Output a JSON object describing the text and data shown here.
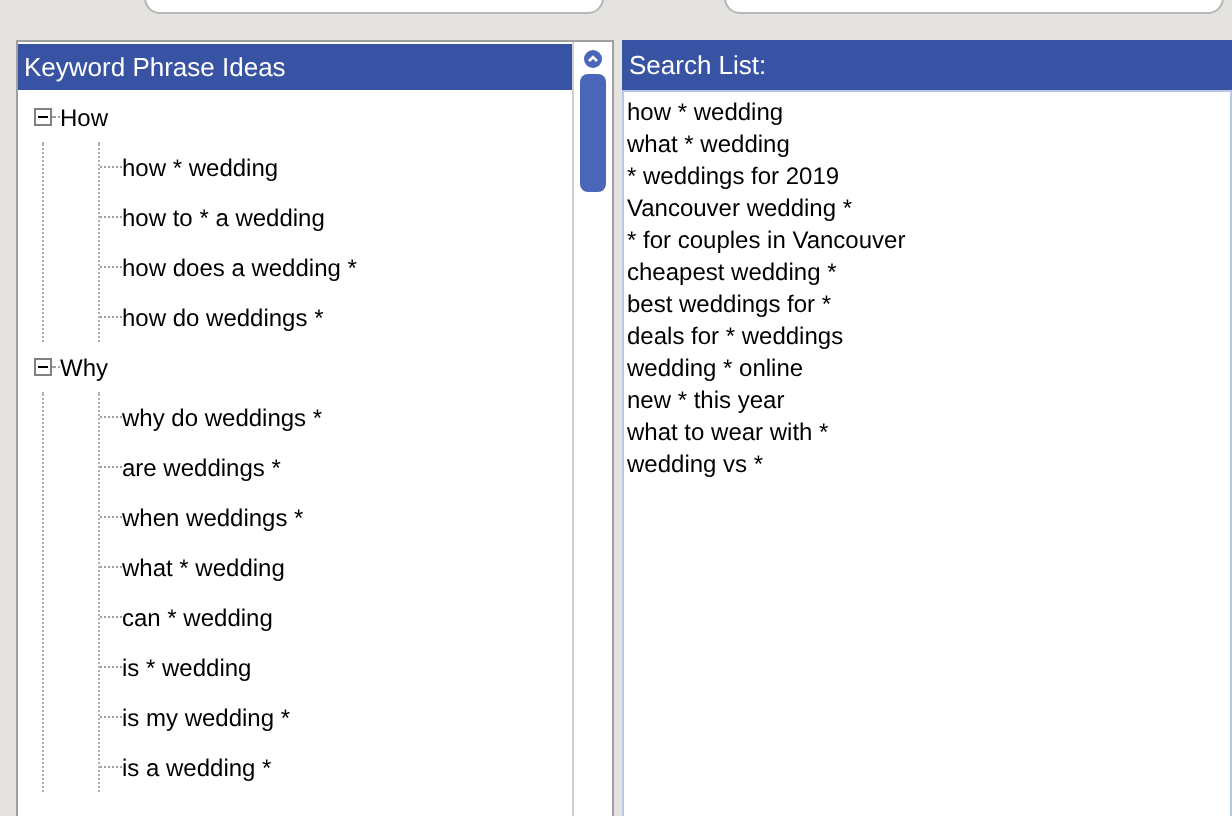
{
  "keyword_panel": {
    "title": "Keyword Phrase Ideas",
    "tree": [
      {
        "label": "How",
        "expanded": true,
        "children": [
          {
            "label": "how * wedding"
          },
          {
            "label": "how to * a wedding"
          },
          {
            "label": "how does a wedding *"
          },
          {
            "label": "how do weddings *"
          }
        ]
      },
      {
        "label": "Why",
        "expanded": true,
        "children": [
          {
            "label": "why do weddings *"
          },
          {
            "label": "are weddings *"
          },
          {
            "label": "when weddings *"
          },
          {
            "label": "what * wedding"
          },
          {
            "label": "can * wedding"
          },
          {
            "label": "is * wedding"
          },
          {
            "label": "is my wedding *"
          },
          {
            "label": "is a wedding *"
          }
        ]
      }
    ]
  },
  "search_list": {
    "title": "Search List:",
    "items": [
      "how * wedding",
      "what * wedding",
      "* weddings for 2019",
      "Vancouver wedding *",
      "* for couples in Vancouver",
      "cheapest wedding *",
      "best weddings for *",
      "deals for * weddings",
      "wedding * online",
      "new * this year",
      "what to wear with *",
      "wedding vs *"
    ]
  }
}
